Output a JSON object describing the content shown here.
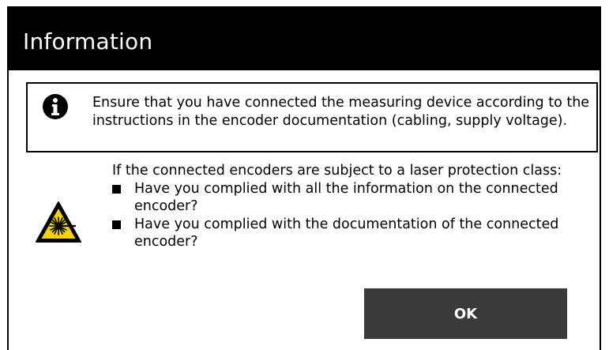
{
  "dialog": {
    "title": "Information",
    "info": {
      "icon": "info-icon",
      "message": "Ensure that you have connected the measuring device according to the instructions in the encoder documentation (cabling, supply voltage)."
    },
    "laser_warning": {
      "icon": "laser-warning-icon",
      "intro": "If the connected encoders are subject to a laser protection class:",
      "bullets": [
        "Have you complied with all the information on the connected encoder?",
        "Have you complied with the documentation of the connected encoder?"
      ]
    },
    "ok_label": "OK"
  },
  "colors": {
    "titlebar_bg": "#000000",
    "titlebar_text": "#ffffff",
    "button_bg": "#3a3a3a",
    "warning_yellow": "#f5d400"
  }
}
